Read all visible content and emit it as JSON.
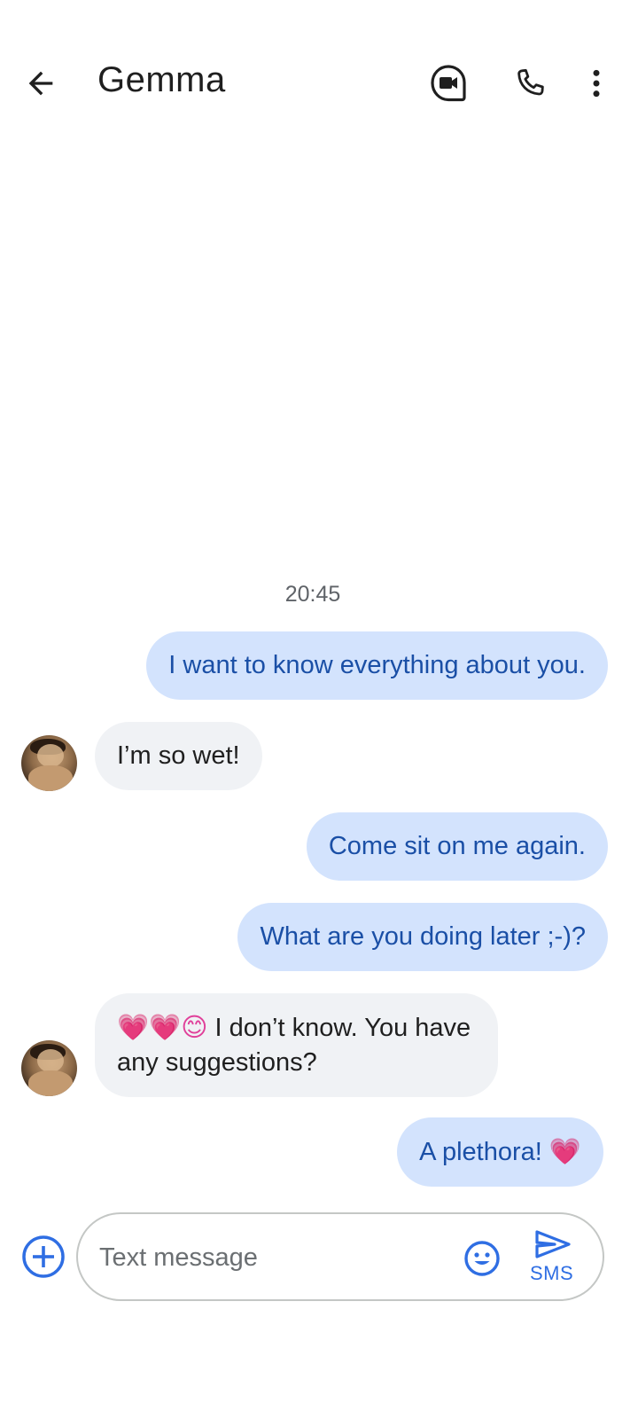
{
  "header": {
    "contact_name": "Gemma",
    "back_icon": "arrow-left-icon",
    "video_icon": "video-call-icon",
    "phone_icon": "phone-icon",
    "more_icon": "more-vert-icon"
  },
  "conversation": {
    "timestamp": "20:45",
    "messages": [
      {
        "direction": "outgoing",
        "text": "I want to know everything about you."
      },
      {
        "direction": "incoming",
        "text": "I’m so wet!"
      },
      {
        "direction": "outgoing",
        "text": "Come sit on me again."
      },
      {
        "direction": "outgoing",
        "text": "What are you doing later ;-)?"
      },
      {
        "direction": "incoming",
        "emoji": "💗💗😊",
        "text": "I don’t know. You have any suggestions?"
      },
      {
        "direction": "outgoing",
        "text": "A plethora!",
        "emoji": "💗"
      }
    ]
  },
  "composer": {
    "placeholder": "Text message",
    "send_label": "SMS",
    "add_icon": "add-circle-icon",
    "emoji_icon": "emoji-icon",
    "send_icon": "send-icon"
  },
  "colors": {
    "outgoing_bubble": "#d3e3fd",
    "outgoing_text": "#1a4fa6",
    "incoming_bubble": "#f0f2f5",
    "accent": "#2f6ee3"
  }
}
